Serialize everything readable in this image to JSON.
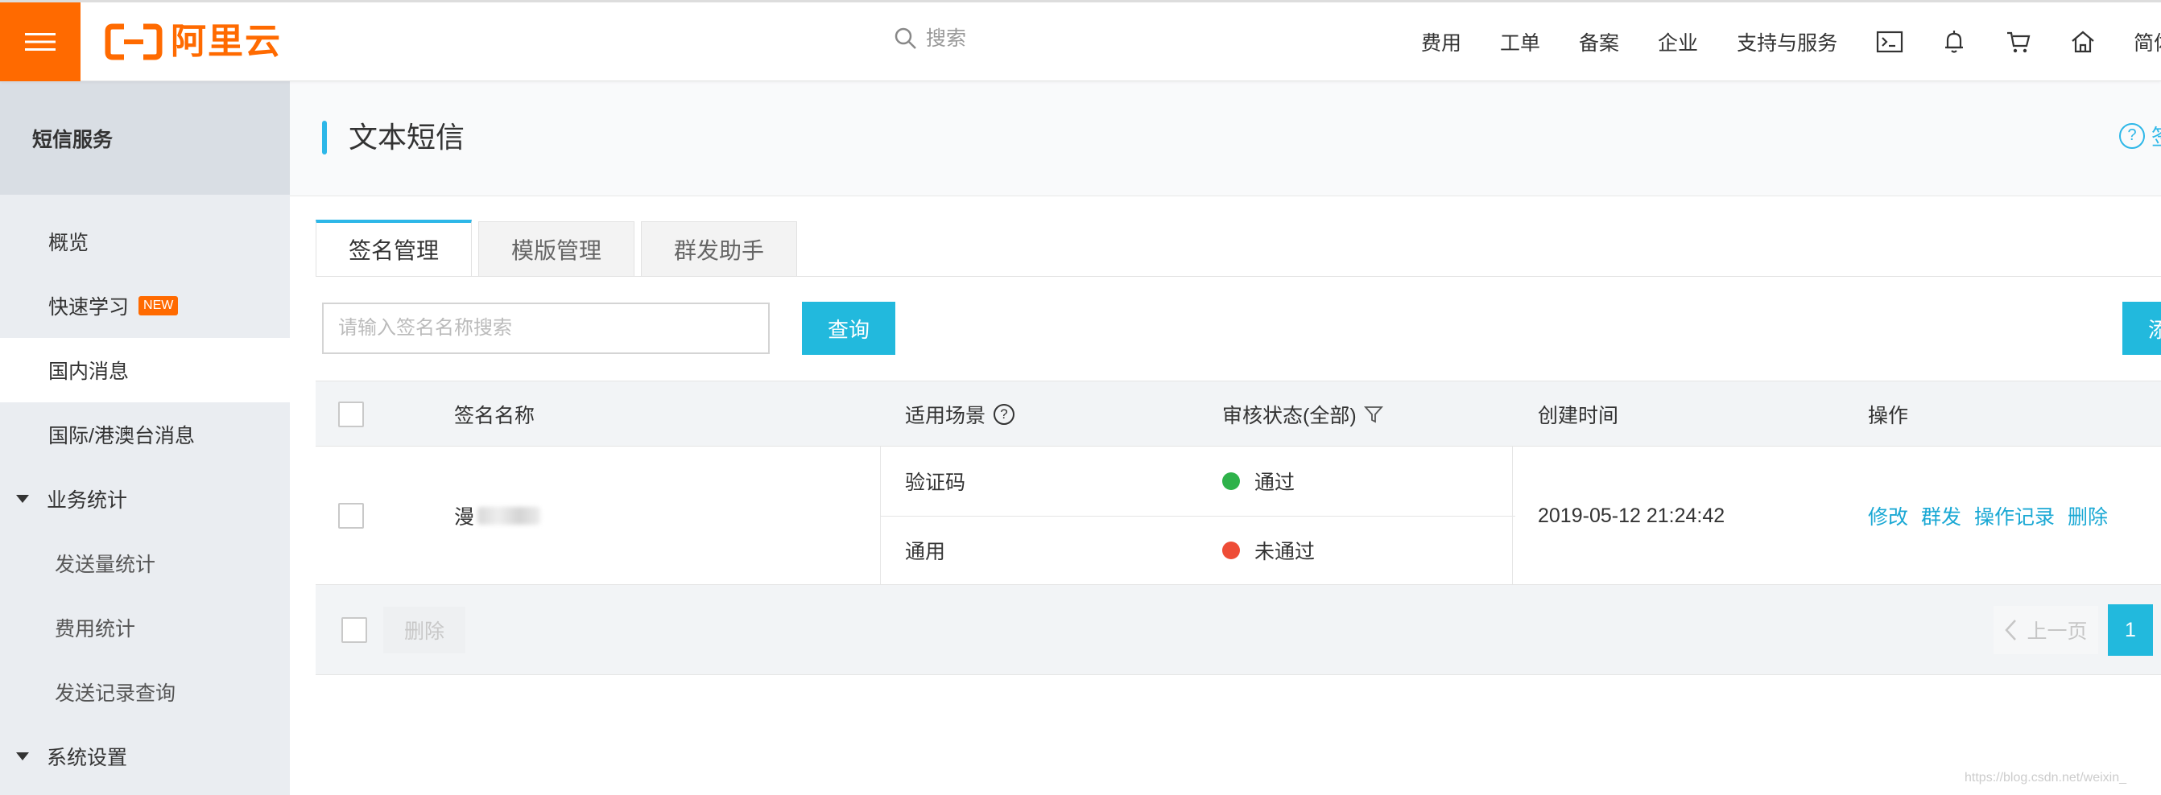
{
  "header": {
    "logo_text": "阿里云",
    "search_placeholder": "搜索",
    "nav": [
      "费用",
      "工单",
      "备案",
      "企业",
      "支持与服务"
    ],
    "lang": "简体"
  },
  "sidebar": {
    "title": "短信服务",
    "items": {
      "overview": "概览",
      "quickstart": "快速学习",
      "quickstart_badge": "NEW",
      "domestic": "国内消息",
      "international": "国际/港澳台消息",
      "stats_group": "业务统计",
      "send_stats": "发送量统计",
      "cost_stats": "费用统计",
      "send_records": "发送记录查询",
      "settings_group": "系统设置"
    }
  },
  "page": {
    "title": "文本短信",
    "help_label": "签"
  },
  "tabs": [
    "签名管理",
    "模版管理",
    "群发助手"
  ],
  "filter": {
    "placeholder": "请输入签名名称搜索",
    "query_label": "查询",
    "add_label": "添"
  },
  "table": {
    "headers": {
      "name": "签名名称",
      "scene": "适用场景",
      "status": "审核状态(全部)",
      "created": "创建时间",
      "actions": "操作"
    },
    "row": {
      "name": "漫",
      "scenes": [
        {
          "scene": "验证码",
          "status": "通过",
          "status_color": "#2eb24a"
        },
        {
          "scene": "通用",
          "status": "未通过",
          "status_color": "#ee4c36"
        }
      ],
      "created": "2019-05-12 21:24:42",
      "actions": [
        "修改",
        "群发",
        "操作记录",
        "删除"
      ]
    },
    "footer": {
      "delete_label": "删除",
      "prev_label": "上一页",
      "page": "1"
    }
  },
  "watermark": "https://blog.csdn.net/weixin_"
}
